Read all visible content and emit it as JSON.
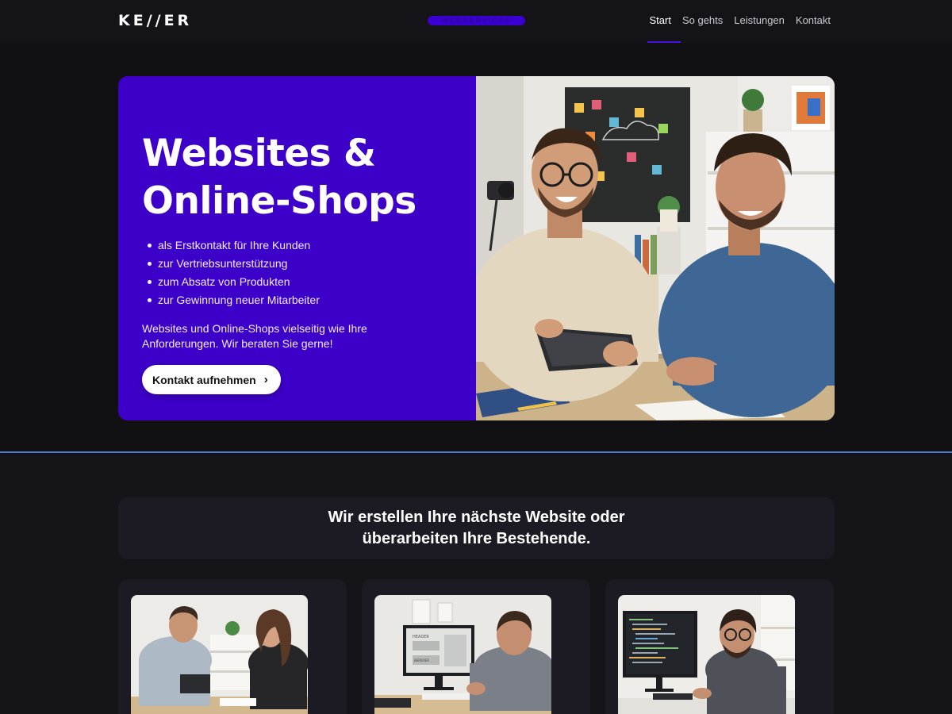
{
  "nav": {
    "logo": "KE//ER",
    "tag": "WEBSERVICES",
    "links": [
      {
        "label": "Start",
        "active": true
      },
      {
        "label": "So gehts",
        "active": false
      },
      {
        "label": "Leistungen",
        "active": false
      },
      {
        "label": "Kontakt",
        "active": false
      }
    ]
  },
  "hero": {
    "title_line1": "Websites &",
    "title_line2": "Online-Shops",
    "bullets": [
      "als Erstkontakt für Ihre Kunden",
      "zur Vertriebsunterstützung",
      "zum Absatz von Produkten",
      "zur Gewinnung neuer Mitarbeiter"
    ],
    "description_line1": "Websites und Online-Shops vielseitig wie Ihre",
    "description_line2": "Anforderungen. Wir beraten Sie gerne!",
    "cta_label": "Kontakt aufnehmen",
    "cta_icon": "chevron-right-icon"
  },
  "intro": {
    "line1": "Wir erstellen Ihre nächste Website oder",
    "line2": "überarbeiten Ihre Bestehende."
  },
  "cards": [
    {
      "image_icon": "consultation-photo"
    },
    {
      "image_icon": "web-design-photo",
      "screen_header_text": "HEADER",
      "screen_button_text": "BERBOER"
    },
    {
      "image_icon": "coding-photo"
    }
  ],
  "colors": {
    "background": "#111114",
    "hero_accent": "#3d00c9",
    "pill_accent": "#3b00d1",
    "divider": "#4d7bd1",
    "card_background": "#1c1b24"
  }
}
